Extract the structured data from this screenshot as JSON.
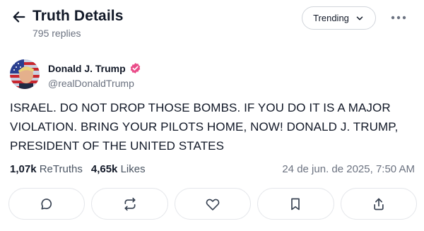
{
  "header": {
    "title": "Truth Details",
    "replies": "795 replies",
    "trending_label": "Trending"
  },
  "post": {
    "author_name": "Donald J. Trump",
    "handle": "@realDonaldTrump",
    "text": "ISRAEL. DO NOT DROP THOSE BOMBS. IF YOU DO IT IS A MAJOR VIOLATION. BRING YOUR PILOTS HOME, NOW!  DONALD J. TRUMP, PRESIDENT OF THE UNITED STATES",
    "retruths_count": "1,07k",
    "retruths_label": "ReTruths",
    "likes_count": "4,65k",
    "likes_label": "Likes",
    "timestamp": "24 de jun. de 2025, 7:50 AM"
  },
  "actions": [
    "comment-icon",
    "retruth-icon",
    "heart-icon",
    "bookmark-icon",
    "share-icon"
  ],
  "colors": {
    "verified_badge": "#ea4c89",
    "border": "#e5e7eb",
    "muted_text": "#6b7280"
  }
}
